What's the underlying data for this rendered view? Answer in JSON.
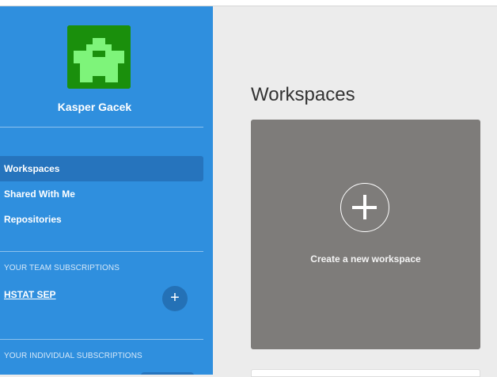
{
  "user": {
    "name": "Kasper Gacek",
    "avatar_icon": "pixel-invader-avatar",
    "avatar_bg": "#1a8f0c",
    "avatar_fg": "#7ef47a"
  },
  "sidebar": {
    "nav": [
      {
        "label": "Workspaces",
        "active": true
      },
      {
        "label": "Shared With Me",
        "active": false
      },
      {
        "label": "Repositories",
        "active": false
      }
    ],
    "team_section": {
      "heading": "YOUR TEAM SUBSCRIPTIONS",
      "items": [
        {
          "label": "HSTAT SEP"
        }
      ],
      "add_icon": "plus-icon"
    },
    "individual_section": {
      "heading": "YOUR INDIVIDUAL SUBSCRIPTIONS"
    }
  },
  "main": {
    "title": "Workspaces",
    "create_card": {
      "label": "Create a new workspace",
      "icon": "plus-circle-icon"
    }
  },
  "colors": {
    "sidebar": "#2f8fde",
    "sidebar_active": "#2674bd",
    "card": "#7e7c7a",
    "background": "#ececec"
  }
}
